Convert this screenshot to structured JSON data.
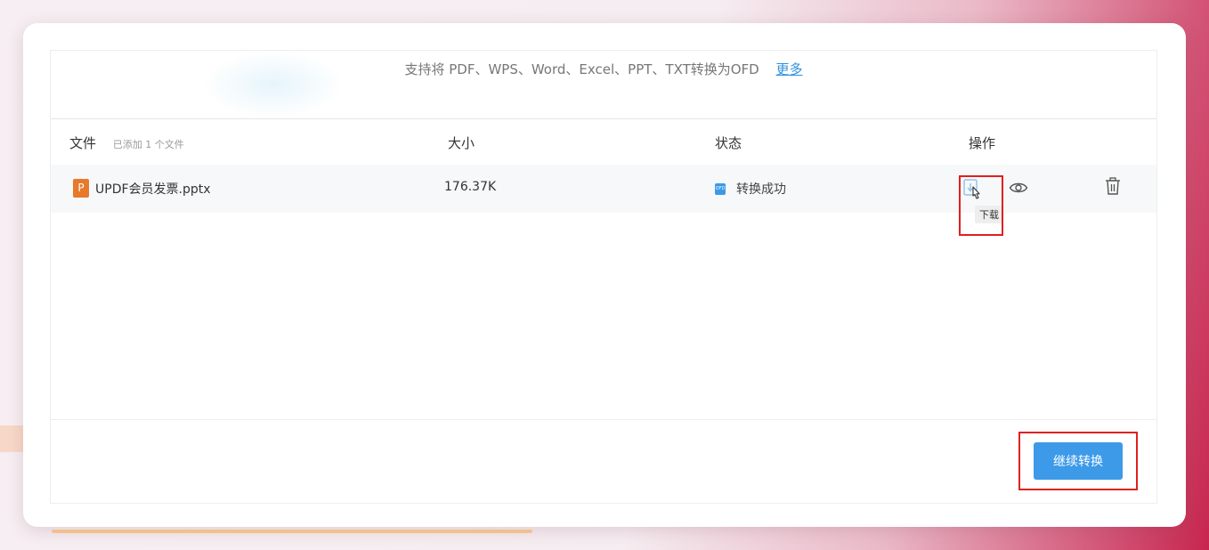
{
  "banner": {
    "support_text": "支持将 PDF、WPS、Word、Excel、PPT、TXT转换为OFD",
    "more_link": "更多"
  },
  "table": {
    "headers": {
      "file": "文件",
      "file_count": "已添加 1 个文件",
      "size": "大小",
      "status": "状态",
      "actions": "操作"
    },
    "rows": [
      {
        "type_badge": "P",
        "name": "UPDF会员发票.pptx",
        "size": "176.37K",
        "status_icon_text": "OFD",
        "status": "转换成功",
        "download_tooltip": "下载"
      }
    ]
  },
  "footer": {
    "continue_label": "继续转换"
  },
  "colors": {
    "accent_blue": "#3d9ae9",
    "link_blue": "#2f8fe0",
    "ppt_orange": "#e7792b",
    "highlight_red": "#e02020"
  },
  "icons": {
    "download": "download-icon",
    "preview": "eye-icon",
    "delete": "trash-icon",
    "cursor": "hand-pointer-icon"
  }
}
